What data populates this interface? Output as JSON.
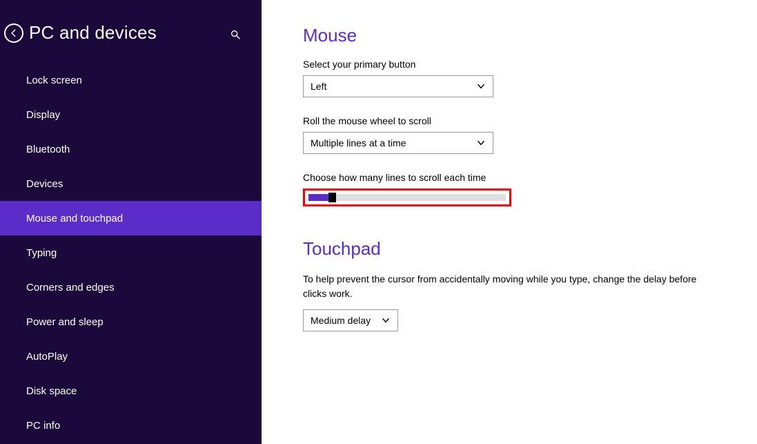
{
  "sidebar": {
    "title": "PC and devices",
    "items": [
      {
        "label": "Lock screen",
        "selected": false
      },
      {
        "label": "Display",
        "selected": false
      },
      {
        "label": "Bluetooth",
        "selected": false
      },
      {
        "label": "Devices",
        "selected": false
      },
      {
        "label": "Mouse and touchpad",
        "selected": true
      },
      {
        "label": "Typing",
        "selected": false
      },
      {
        "label": "Corners and edges",
        "selected": false
      },
      {
        "label": "Power and sleep",
        "selected": false
      },
      {
        "label": "AutoPlay",
        "selected": false
      },
      {
        "label": "Disk space",
        "selected": false
      },
      {
        "label": "PC info",
        "selected": false
      }
    ]
  },
  "mouse": {
    "heading": "Mouse",
    "primary_button_label": "Select your primary button",
    "primary_button_value": "Left",
    "wheel_label": "Roll the mouse wheel to scroll",
    "wheel_value": "Multiple lines at a time",
    "lines_label": "Choose how many lines to scroll each time",
    "lines_slider": {
      "fill_pct": 12,
      "thumb_pct": 12
    }
  },
  "touchpad": {
    "heading": "Touchpad",
    "help_text": "To help prevent the cursor from accidentally moving while you type, change the delay before clicks work.",
    "delay_value": "Medium delay"
  },
  "colors": {
    "sidebar_bg": "#1a093a",
    "accent": "#5a2dc8",
    "highlight_border": "#ff0000"
  }
}
